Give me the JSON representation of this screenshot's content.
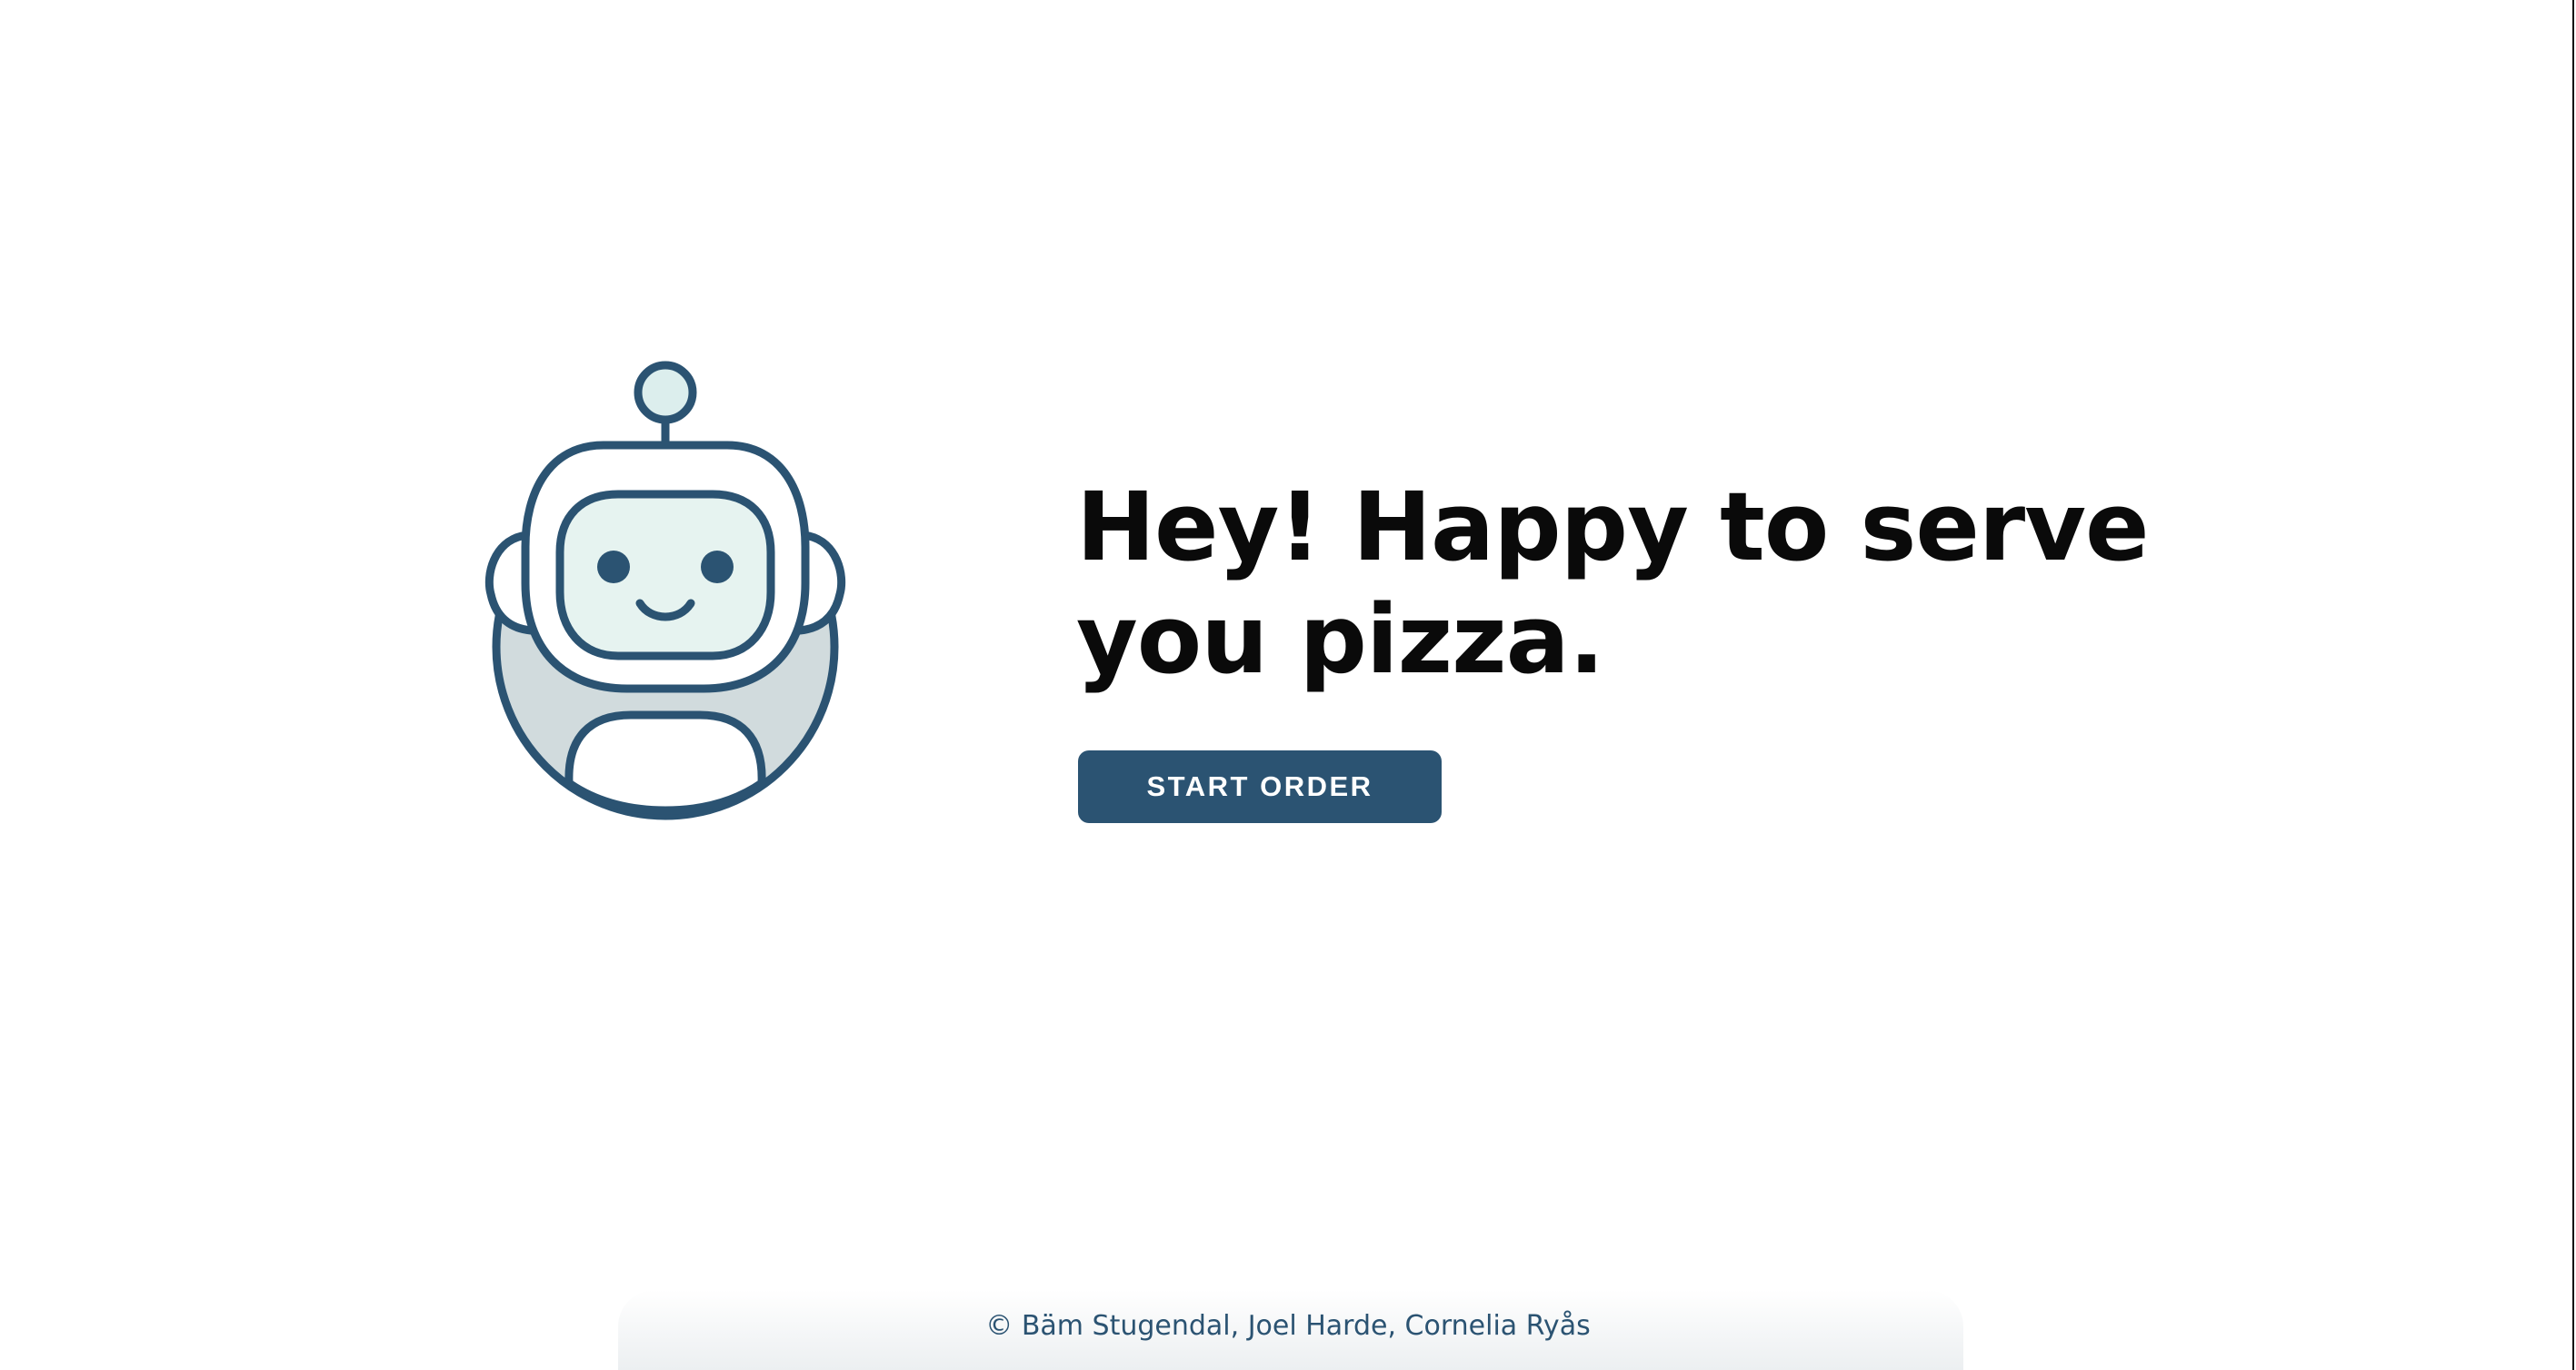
{
  "hero": {
    "headline": "Hey! Happy to serve you pizza.",
    "button_label": "START ORDER"
  },
  "mascot": {
    "icon": "robot-icon",
    "colors": {
      "outline": "#2b5372",
      "face": "#e6f3f0",
      "body": "#d1dbdd",
      "antenna_ball": "#dceeed"
    }
  },
  "footer": {
    "copyright": "© Bäm Stugendal, Joel Harde, Cornelia Ryås"
  },
  "theme": {
    "accent": "#2b5372",
    "background": "#ffffff",
    "text": "#0a0a0a"
  }
}
